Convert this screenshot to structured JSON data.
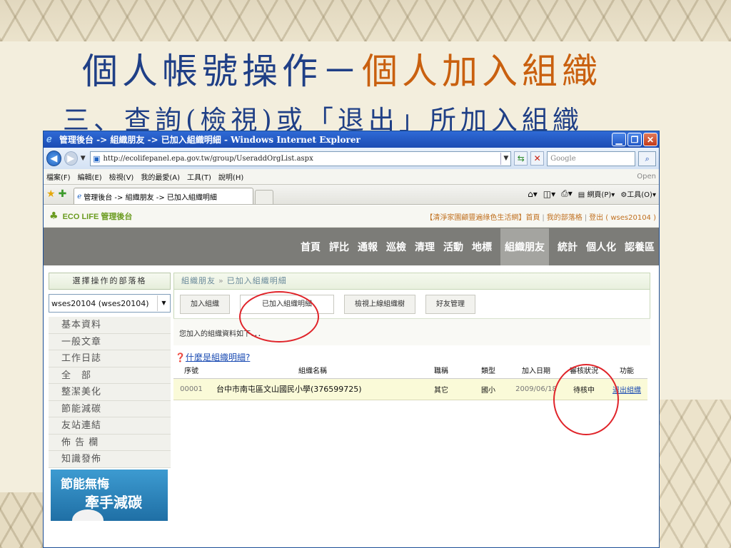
{
  "slide": {
    "title_part1": "個人帳號操作－",
    "title_part2": "個人加入組織",
    "subtitle": "三、查詢(檢視)或「退出」所加入組織"
  },
  "browser": {
    "window_title": "管理後台 -> 組織朋友 -> 已加入組織明細 - Windows Internet Explorer",
    "url": "http://ecolifepanel.epa.gov.tw/group/UseraddOrgList.aspx",
    "search_placeholder": "Google",
    "menu": [
      "檔案(F)",
      "編輯(E)",
      "檢視(V)",
      "我的最愛(A)",
      "工具(T)",
      "說明(H)"
    ],
    "menu_right": "Open",
    "tab_title": "管理後台 -> 組織朋友 -> 已加入組織明細",
    "cmd_page": "網頁(P)",
    "cmd_tools": "工具(O)"
  },
  "site": {
    "brand": "ECO LIFE 管理後台",
    "header_links": "【清淨家園顧豐遍綠色生活網】首頁",
    "header_link2": "我的部落格",
    "header_link3": "登出 ( wses20104 )",
    "nav": [
      "首頁",
      "評比",
      "通報",
      "巡檢",
      "清理",
      "活動",
      "地標",
      "組織朋友",
      "統計",
      "個人化",
      "認養區"
    ],
    "nav_active": "組織朋友"
  },
  "sidebar": {
    "heading": "選擇操作的部落格",
    "blog_selected": "wses20104 (wses20104)",
    "items": [
      "基本資料",
      "一般文章",
      "工作日誌",
      "全　部",
      "整潔美化",
      "節能減碳",
      "友站連結",
      "佈 告 欄",
      "知識發佈"
    ],
    "banner_line1": "節能無悔",
    "banner_line2": "牽手減碳"
  },
  "main": {
    "breadcrumb_root": "組織朋友",
    "breadcrumb_sep": "»",
    "breadcrumb_current": "已加入組織明細",
    "tabs": [
      "加入組織",
      "已加入組織明細",
      "檢視上線組織樹",
      "好友管理"
    ],
    "info": "您加入的組織資料如下．．．",
    "help_link": "什麼是組織明細?",
    "table": {
      "headers": [
        "序號",
        "組織名稱",
        "職稱",
        "類型",
        "加入日期",
        "審核狀況",
        "功能"
      ],
      "rows": [
        [
          "00001",
          "台中市南屯區文山國民小學(376599725)",
          "其它",
          "國小",
          "2009/06/18",
          "待核中",
          "退出組織"
        ]
      ]
    }
  }
}
